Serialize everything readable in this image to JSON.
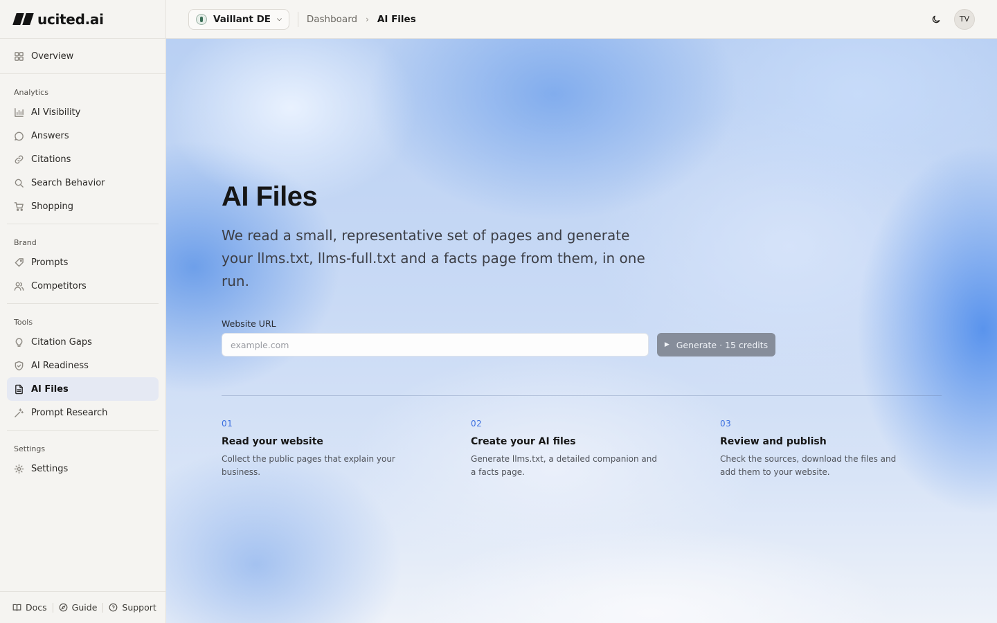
{
  "brand": {
    "name": "ucited.ai"
  },
  "sidebar": {
    "overview": {
      "label": "Overview",
      "icon": "grid-icon"
    },
    "groups": [
      {
        "label": "Analytics",
        "items": [
          {
            "label": "AI Visibility",
            "icon": "bar-chart-icon"
          },
          {
            "label": "Answers",
            "icon": "chat-bubble-icon"
          },
          {
            "label": "Citations",
            "icon": "link-icon"
          },
          {
            "label": "Search Behavior",
            "icon": "search-icon"
          },
          {
            "label": "Shopping",
            "icon": "cart-icon"
          }
        ]
      },
      {
        "label": "Brand",
        "items": [
          {
            "label": "Prompts",
            "icon": "tag-icon"
          },
          {
            "label": "Competitors",
            "icon": "users-icon"
          }
        ]
      },
      {
        "label": "Tools",
        "items": [
          {
            "label": "Citation Gaps",
            "icon": "lightbulb-icon"
          },
          {
            "label": "AI Readiness",
            "icon": "shield-check-icon"
          },
          {
            "label": "AI Files",
            "icon": "file-text-icon",
            "active": true
          },
          {
            "label": "Prompt Research",
            "icon": "sparkle-wand-icon"
          }
        ]
      },
      {
        "label": "Settings",
        "items": [
          {
            "label": "Settings",
            "icon": "gear-icon"
          }
        ]
      }
    ],
    "footer": {
      "docs": "Docs",
      "guide": "Guide",
      "support": "Support"
    }
  },
  "header": {
    "workspace": "Vaillant DE",
    "breadcrumb": [
      "Dashboard",
      "AI Files"
    ],
    "avatar_initials": "TV"
  },
  "main": {
    "title": "AI Files",
    "description": "We read a small, representative set of pages and generate your llms.txt, llms-full.txt and a facts page from them, in one run.",
    "url_label": "Website URL",
    "url_placeholder": "example.com",
    "url_value": "",
    "generate_button": "Generate · 15 credits",
    "steps": [
      {
        "num": "01",
        "title": "Read your website",
        "desc": "Collect the public pages that explain your business."
      },
      {
        "num": "02",
        "title": "Create your AI files",
        "desc": "Generate llms.txt, a detailed companion and a facts page."
      },
      {
        "num": "03",
        "title": "Review and publish",
        "desc": "Check the sources, download the files and add them to your website."
      }
    ]
  },
  "colors": {
    "accent": "#3c6fe0",
    "active_nav_bg": "#e5e9f3",
    "button_bg": "#868d9a"
  }
}
